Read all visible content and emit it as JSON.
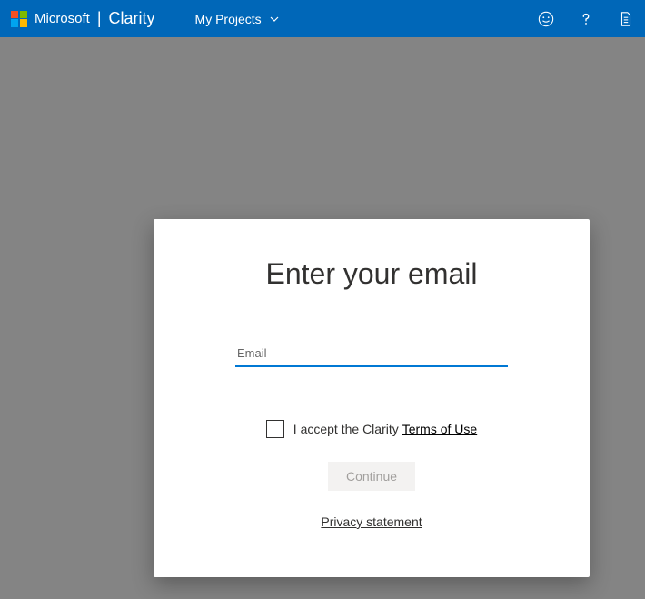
{
  "header": {
    "brand": "Microsoft",
    "product": "Clarity",
    "nav_label": "My Projects"
  },
  "modal": {
    "title": "Enter your email",
    "email_placeholder": "Email",
    "email_value": "",
    "consent_prefix": "I accept the Clarity",
    "terms_label": "Terms of Use",
    "continue_label": "Continue",
    "privacy_label": "Privacy statement"
  }
}
